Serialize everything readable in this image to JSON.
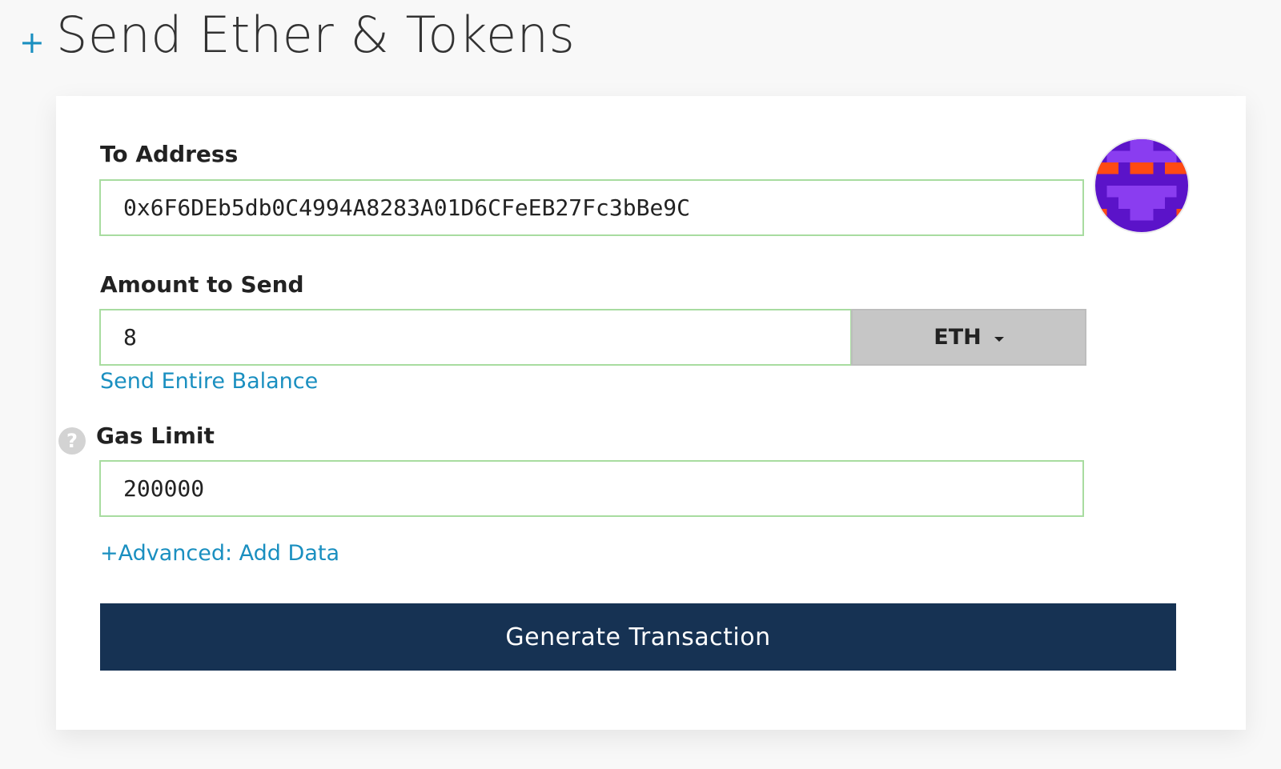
{
  "header": {
    "expand_symbol": "+",
    "title": "Send Ether & Tokens"
  },
  "form": {
    "to_address": {
      "label": "To Address",
      "value": "0x6F6DEb5db0C4994A8283A01D6CFeEB27Fc3bBe9C"
    },
    "amount": {
      "label": "Amount to Send",
      "value": "8",
      "unit": "ETH",
      "send_entire_balance": "Send Entire Balance"
    },
    "gas_limit": {
      "label": "Gas Limit",
      "value": "200000",
      "help_symbol": "?"
    },
    "advanced_link": "+Advanced: Add Data",
    "submit_label": "Generate Transaction"
  },
  "colors": {
    "accent": "#1a8fc0",
    "button": "#163253",
    "field_border": "#a8dca0",
    "dropdown_bg": "#c6c6c6"
  },
  "icons": [
    "plus-icon",
    "help-icon",
    "caret-down-icon",
    "identicon-avatar"
  ]
}
